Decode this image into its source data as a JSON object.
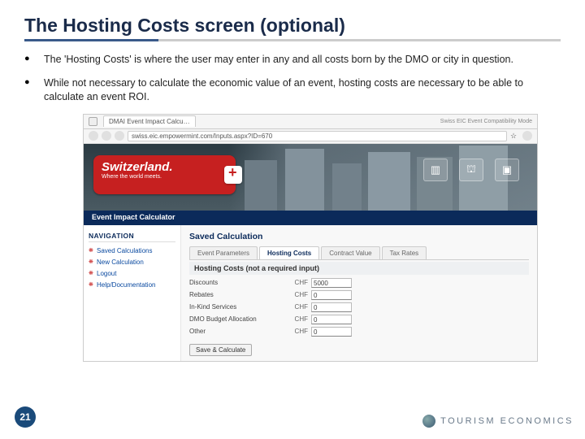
{
  "title": "The Hosting Costs screen (optional)",
  "bullets": [
    "The 'Hosting Costs' is where the user may enter in any and all costs born by the DMO or city in question.",
    "While not necessary to calculate the economic value of an event, hosting costs are necessary to be able to calculate an event ROI."
  ],
  "browser": {
    "tab_title": "DMAI Event Impact Calcu…",
    "url": "swiss.eic.empowermint.com/Inputs.aspx?ID=670",
    "right_caption": "Swiss EIC Event Compatibility Mode"
  },
  "banner": {
    "logo_name": "Switzerland.",
    "logo_tag": "Where the world meets.",
    "icons": [
      "bar-chart",
      "building",
      "bag"
    ]
  },
  "eic_bar": "Event Impact Calculator",
  "sidebar": {
    "heading": "NAVIGATION",
    "items": [
      "Saved Calculations",
      "New Calculation",
      "Logout",
      "Help/Documentation"
    ]
  },
  "main": {
    "saved_heading": "Saved Calculation",
    "tabs": [
      "Event Parameters",
      "Hosting Costs",
      "Contract Value",
      "Tax Rates"
    ],
    "active_tab_index": 1,
    "subhead": "Hosting Costs (not a required input)",
    "currency": "CHF",
    "rows": [
      {
        "label": "Discounts",
        "value": "5000"
      },
      {
        "label": "Rebates",
        "value": "0"
      },
      {
        "label": "In-Kind Services",
        "value": "0"
      },
      {
        "label": "DMO Budget Allocation",
        "value": "0"
      },
      {
        "label": "Other",
        "value": "0"
      }
    ],
    "save_button": "Save & Calculate"
  },
  "page_number": "21",
  "footer_brand": "TOURISM ECONOMICS"
}
